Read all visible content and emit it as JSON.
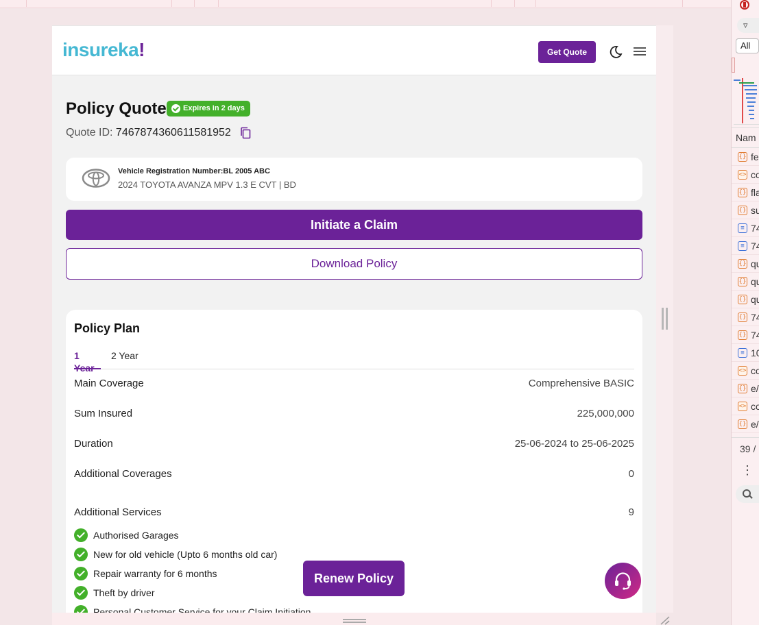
{
  "app": {
    "logo_main": "insureka",
    "logo_bang": "!",
    "get_quote_label": "Get Quote",
    "accent": "#6b2298",
    "brand": "#45b8d3",
    "success": "#43b02a"
  },
  "quote": {
    "title": "Policy Quote",
    "badge": "Expires in 2 days",
    "id_label": "Quote ID: ",
    "id_value": "7467874360611581952"
  },
  "vehicle": {
    "registration": "Vehicle Registration Number:BL 2005 ABC",
    "model": "2024 TOYOTA AVANZA MPV 1.3 E CVT | BD",
    "brand_icon": "toyota-logo-icon"
  },
  "actions": {
    "claim": "Initiate a Claim",
    "download": "Download Policy",
    "renew": "Renew Policy"
  },
  "plan": {
    "title": "Policy Plan",
    "tabs": [
      {
        "label": "1 Year",
        "active": true
      },
      {
        "label": "2 Year",
        "active": false
      }
    ],
    "rows": [
      {
        "label": "Main Coverage",
        "value": "Comprehensive BASIC"
      },
      {
        "label": "Sum Insured",
        "value": "225,000,000"
      },
      {
        "label": "Duration",
        "value": "25-06-2024 to 25-06-2025"
      },
      {
        "label": "Additional Coverages",
        "value": "0"
      },
      {
        "label": "Additional Services",
        "value": "9"
      }
    ],
    "services": [
      "Authorised Garages",
      "New for old vehicle (Upto 6 months old car)",
      "Repair warranty for 6 months",
      "Theft by driver",
      "Personal Customer Service for your Claim Initiation"
    ]
  },
  "devtools": {
    "filter_all": "All",
    "name_header": "Nam",
    "rows": [
      {
        "icon": "fetch",
        "text": "fe"
      },
      {
        "icon": "xhr",
        "text": "co"
      },
      {
        "icon": "fetch",
        "text": "fla"
      },
      {
        "icon": "fetch",
        "text": "su"
      },
      {
        "icon": "doc",
        "text": "74"
      },
      {
        "icon": "doc",
        "text": "74"
      },
      {
        "icon": "fetch",
        "text": "qu"
      },
      {
        "icon": "fetch",
        "text": "qu"
      },
      {
        "icon": "fetch",
        "text": "qu"
      },
      {
        "icon": "fetch",
        "text": "74"
      },
      {
        "icon": "fetch",
        "text": "74"
      },
      {
        "icon": "doc",
        "text": "10"
      },
      {
        "icon": "xhr",
        "text": "co"
      },
      {
        "icon": "fetch",
        "text": "e/"
      },
      {
        "icon": "xhr",
        "text": "co"
      },
      {
        "icon": "fetch",
        "text": "e/"
      }
    ],
    "count": "39 /"
  }
}
